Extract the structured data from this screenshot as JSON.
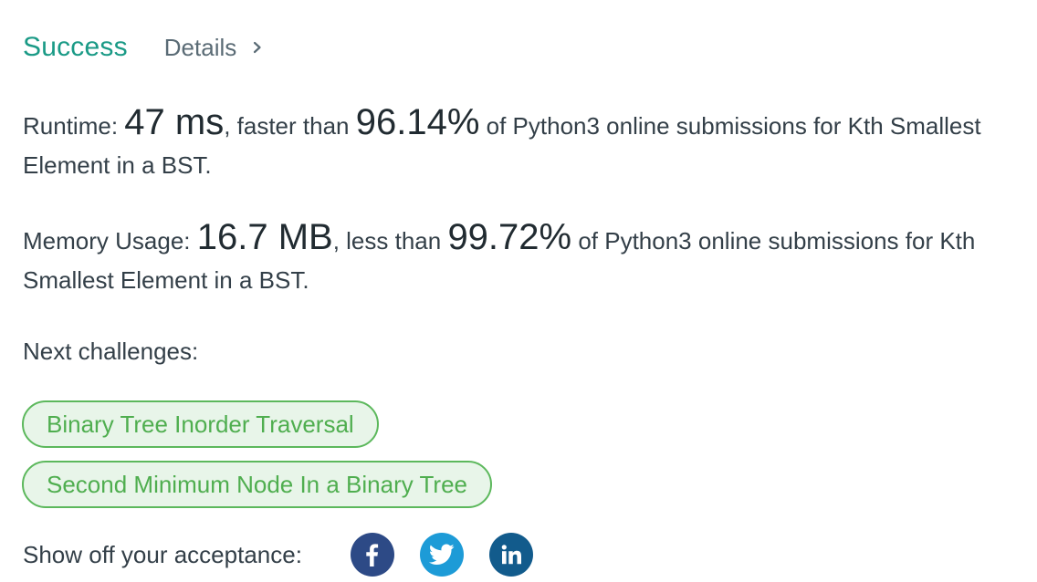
{
  "header": {
    "status": "Success",
    "details_label": "Details"
  },
  "runtime": {
    "label": "Runtime: ",
    "value": "47 ms",
    "comparison": ", faster than ",
    "percent": "96.14%",
    "suffix": " of Python3 online submissions for Kth Smallest Element in a BST."
  },
  "memory": {
    "label": "Memory Usage: ",
    "value": "16.7 MB",
    "comparison": ", less than ",
    "percent": "99.72%",
    "suffix": " of Python3 online submissions for Kth Smallest Element in a BST."
  },
  "next": {
    "label": "Next challenges:",
    "challenges": [
      "Binary Tree Inorder Traversal",
      "Second Minimum Node In a Binary Tree"
    ]
  },
  "share": {
    "label": "Show off your acceptance:",
    "icons": [
      "facebook-icon",
      "twitter-icon",
      "linkedin-icon"
    ]
  },
  "colors": {
    "success": "#1a9a86",
    "chip_border": "#5cb85c",
    "chip_bg": "#e8f5e9",
    "facebook": "#2d4a86",
    "twitter": "#1d9bd7",
    "linkedin": "#125b8c"
  }
}
